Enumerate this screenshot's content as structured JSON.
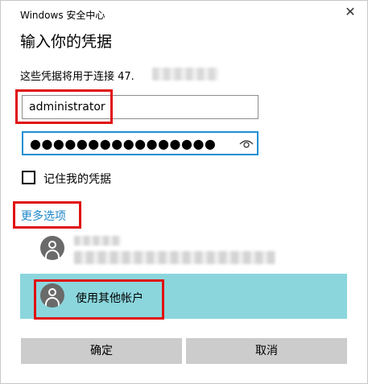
{
  "window": {
    "title": "Windows 安全中心",
    "close_glyph": "✕"
  },
  "heading": "输入你的凭据",
  "subtext": "这些凭据将用于连接 47.",
  "username_field": {
    "value": "administrator"
  },
  "password_field": {
    "masked_value": "●●●●●●●●●●●●●●●●",
    "reveal_icon": "eye-icon"
  },
  "remember": {
    "label": "记住我的凭据",
    "checked": false
  },
  "more_options": {
    "label": "更多选项",
    "color": "#1e86c8"
  },
  "accounts": {
    "other_account_label": "使用其他帐户",
    "selected_color": "#8bd6dd"
  },
  "buttons": {
    "ok_label": "确定",
    "cancel_label": "取消"
  },
  "annotation_color": "#e01010"
}
